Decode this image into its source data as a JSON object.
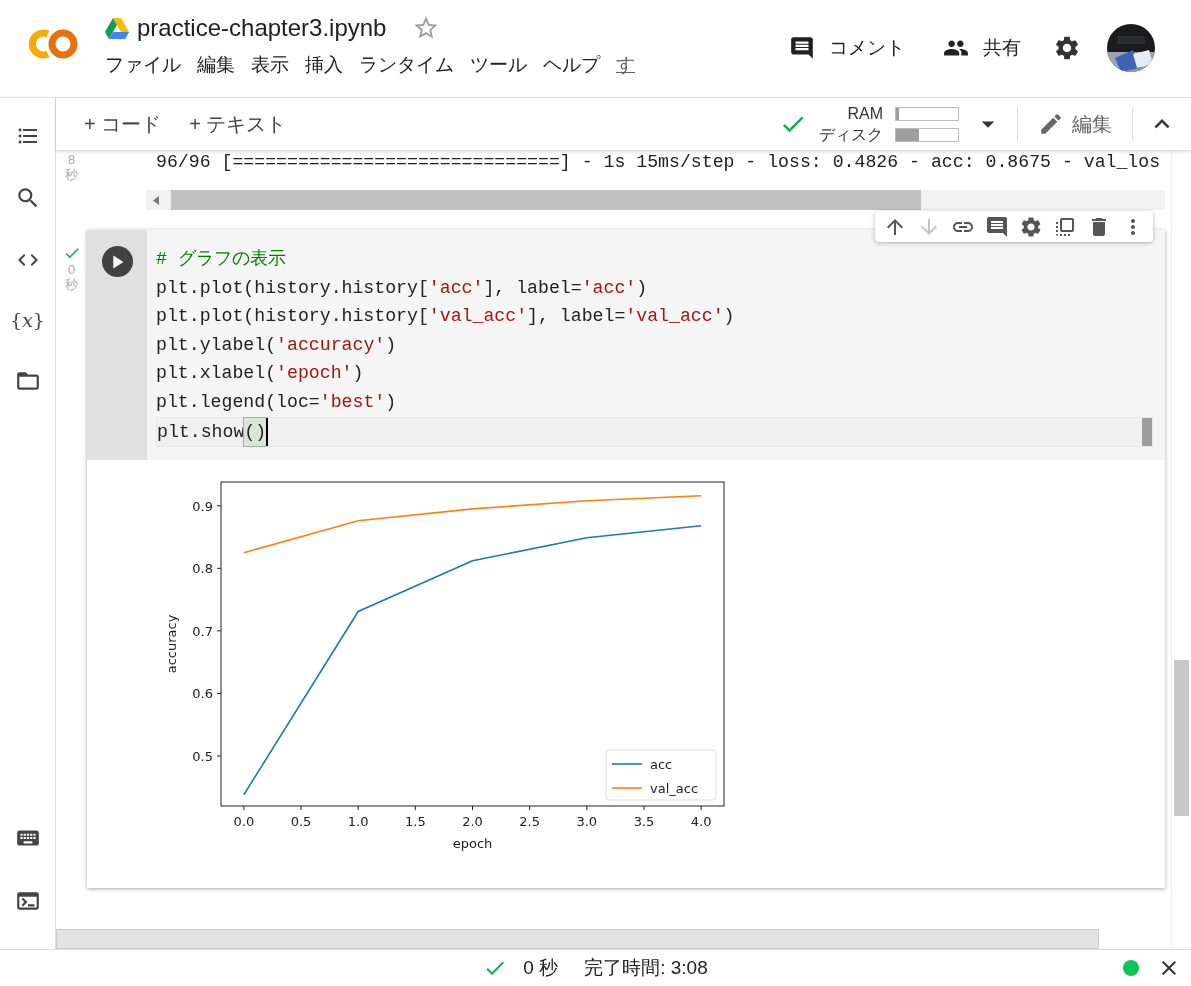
{
  "header": {
    "title": "practice-chapter3.ipynb",
    "starred": false,
    "menu": [
      "ファイル",
      "編集",
      "表示",
      "挿入",
      "ランタイム",
      "ツール",
      "ヘルプ",
      "す"
    ],
    "actions": [
      {
        "kind": "comment",
        "label": "コメント"
      },
      {
        "kind": "share",
        "label": "共有"
      }
    ]
  },
  "sidebar": {
    "variables_glyph": "{𝑥}"
  },
  "toolbar": {
    "add": [
      "+ コード",
      "+ テキスト"
    ],
    "connected": true,
    "resources": [
      {
        "label": "RAM",
        "level": 0.05
      },
      {
        "label": "ディスク",
        "level": 0.37
      }
    ],
    "edit_label": "編集"
  },
  "previous_output": {
    "time": "8",
    "unit": "秒",
    "text": "96/96 [==============================] - 1s 15ms/step - loss: 0.4826 - acc: 0.8675 - val_los"
  },
  "cell": {
    "executed": true,
    "time": "0",
    "unit": "秒",
    "toolbar": [
      {
        "kind": "up",
        "disabled": false
      },
      {
        "kind": "down",
        "disabled": true
      },
      {
        "kind": "link",
        "disabled": false
      },
      {
        "kind": "comment",
        "disabled": false
      },
      {
        "kind": "settings",
        "disabled": false
      },
      {
        "kind": "mirror",
        "disabled": false
      },
      {
        "kind": "delete",
        "disabled": false
      },
      {
        "kind": "more",
        "disabled": false
      }
    ],
    "code": [
      [
        {
          "kind": "comment",
          "text": "# グラフの表示"
        }
      ],
      [
        {
          "kind": "plain",
          "text": "plt.plot(history.history["
        },
        {
          "kind": "string",
          "text": "'acc'"
        },
        {
          "kind": "plain",
          "text": "], label="
        },
        {
          "kind": "string",
          "text": "'acc'"
        },
        {
          "kind": "plain",
          "text": ")"
        }
      ],
      [
        {
          "kind": "plain",
          "text": "plt.plot(history.history["
        },
        {
          "kind": "string",
          "text": "'val_acc'"
        },
        {
          "kind": "plain",
          "text": "], label="
        },
        {
          "kind": "string",
          "text": "'val_acc'"
        },
        {
          "kind": "plain",
          "text": ")"
        }
      ],
      [
        {
          "kind": "plain",
          "text": "plt.ylabel("
        },
        {
          "kind": "string",
          "text": "'accuracy'"
        },
        {
          "kind": "plain",
          "text": ")"
        }
      ],
      [
        {
          "kind": "plain",
          "text": "plt.xlabel("
        },
        {
          "kind": "string",
          "text": "'epoch'"
        },
        {
          "kind": "plain",
          "text": ")"
        }
      ],
      [
        {
          "kind": "plain",
          "text": "plt.legend(loc="
        },
        {
          "kind": "string",
          "text": "'best'"
        },
        {
          "kind": "plain",
          "text": ")"
        }
      ],
      [
        {
          "kind": "plain",
          "text": "plt.show"
        },
        {
          "kind": "bracket",
          "text": "()"
        }
      ]
    ],
    "chart_data": {
      "type": "line",
      "xlabel": "epoch",
      "ylabel": "accuracy",
      "x": [
        0,
        1,
        2,
        3,
        4
      ],
      "series": [
        {
          "name": "acc",
          "color": "#1f77b4",
          "values": [
            0.438,
            0.731,
            0.812,
            0.849,
            0.868
          ]
        },
        {
          "name": "val_acc",
          "color": "#ff7f0e",
          "values": [
            0.825,
            0.876,
            0.895,
            0.908,
            0.916
          ]
        }
      ],
      "xlim": [
        -0.2,
        4.2
      ],
      "ylim": [
        0.42,
        0.938
      ],
      "xticks": [
        {
          "value": 0,
          "label": "0.0"
        },
        {
          "value": 0.5,
          "label": "0.5"
        },
        {
          "value": 1,
          "label": "1.0"
        },
        {
          "value": 1.5,
          "label": "1.5"
        },
        {
          "value": 2,
          "label": "2.0"
        },
        {
          "value": 2.5,
          "label": "2.5"
        },
        {
          "value": 3,
          "label": "3.0"
        },
        {
          "value": 3.5,
          "label": "3.5"
        },
        {
          "value": 4,
          "label": "4.0"
        }
      ],
      "yticks": [
        0.5,
        0.6,
        0.7,
        0.8,
        0.9
      ],
      "legend": "lower right"
    }
  },
  "status_bar": {
    "ok": true,
    "duration": "0 秒",
    "finished": "完了時間: 3:08",
    "connected": true
  }
}
